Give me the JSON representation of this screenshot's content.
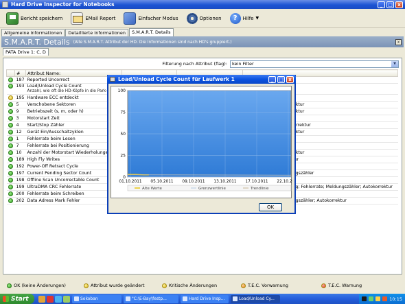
{
  "window": {
    "title": "Hard Drive Inspector for Notebooks",
    "buttons": [
      "_",
      "□",
      "x"
    ]
  },
  "toolbar": {
    "save_label": "Bericht speichern",
    "email_label": "EMail Report",
    "simple_label": "Einfacher Modus",
    "options_label": "Optionen",
    "help_label": "Hilfe"
  },
  "tabs": [
    {
      "label": "Allgemeine Informationen"
    },
    {
      "label": "Detaillierte Informationen"
    },
    {
      "label": "S.M.A.R.T. Details"
    }
  ],
  "header": {
    "title": "S.M.A.R.T. Details",
    "subtitle": "(Alle S.M.A.R.T. Attribut der HD. Die Informationen sind nach HD's gruppiert.)",
    "close": "x"
  },
  "drive_tab": "PATA Drive 1: C, D",
  "filter": {
    "label": "Filterung nach Attribut (flag):",
    "value": "kein Filter"
  },
  "table": {
    "columns": [
      "#",
      "Attribut Name:"
    ],
    "rows": [
      {
        "status": "g",
        "id": "187",
        "name": "Reported Uncorrect",
        "c3": "",
        "c4": "",
        "c5": "Autokorrektur"
      },
      {
        "status": "g",
        "id": "193",
        "name": "Load/Unload Cycle Count",
        "c3": "",
        "c4": "",
        "c5": "Autokorrektur",
        "desc": "Anzahl, wie oft die HD-Köpfe in die Park- oder Arbeitsposition gebracht wurden."
      },
      {
        "status": "y",
        "id": "195",
        "name": "Hardware ECC entdeckt",
        "c3": "",
        "c4": "",
        "c5": "gszähler"
      },
      {
        "status": "g",
        "id": "5",
        "name": "Verschobene Sektoren",
        "c3": "",
        "c4": "",
        "c5": "ldungszähler; Autokorrektur"
      },
      {
        "status": "g",
        "id": "9",
        "name": "Betriebszeit (s, m, oder h)",
        "c3": "",
        "c4": "",
        "c5": "ldungszähler; Autokorrektur"
      },
      {
        "status": "g",
        "id": "3",
        "name": "Motorstart Zeit",
        "c3": "",
        "c4": "",
        "c5": ""
      },
      {
        "status": "g",
        "id": "4",
        "name": "Start/Stop Zähler",
        "c3": "",
        "c4": "",
        "c5": "Meldungszähler; Autokorrektur"
      },
      {
        "status": "g",
        "id": "12",
        "name": "Gerät Ein/Ausschaltzyklen",
        "c3": "",
        "c4": "",
        "c5": "ldungszähler; Autokorrektur"
      },
      {
        "status": "g",
        "id": "1",
        "name": "Fehlerrate beim Lesen",
        "c3": "",
        "c4": "",
        "c5": "Leistung; Fehlerrate"
      },
      {
        "status": "g",
        "id": "7",
        "name": "Fehlerrate bei Positionierung",
        "c3": "",
        "c4": "",
        "c5": "Leistung; Fehlerrate"
      },
      {
        "status": "g",
        "id": "10",
        "name": "Anzahl der Motorstart Wiederholungen",
        "c3": "",
        "c4": "",
        "c5": "ldungszähler; Autokorrektur"
      },
      {
        "status": "g",
        "id": "189",
        "name": "High Fly Writes",
        "c3": "",
        "c4": "",
        "c5": "Fehlerrate; Autokorrektur"
      },
      {
        "status": "g",
        "id": "192",
        "name": "Power-Off Retract Cycle",
        "c3": "",
        "c4": "",
        "c5": "Autokorrektur"
      },
      {
        "status": "g",
        "id": "197",
        "name": "Current Pending Sector Count",
        "c3": "100%",
        "c4": "100",
        "c5": "Online Statistik; Meldungszähler"
      },
      {
        "status": "g",
        "id": "198",
        "name": "Offline Scan Uncorrectable Count",
        "c3": "100%",
        "c4": "100",
        "c5": "Meldungszähler"
      },
      {
        "status": "g",
        "id": "199",
        "name": "UltraDMA CRC Fehlerrate",
        "c3": "100%",
        "c4": "200",
        "c5": "Online Statistik; Leistung; Fehlerrate; Meldungszähler; Autokorrektur"
      },
      {
        "status": "g",
        "id": "200",
        "name": "Fehlerrate beim Schreiben",
        "c3": "100%",
        "c4": "100",
        "c5": "Fehlerrate"
      },
      {
        "status": "g",
        "id": "202",
        "name": "Data Adress Mark Fehler",
        "c3": "100%",
        "c4": "100",
        "c5": "Online Statistik; Meldungszähler; Autokorrektur"
      }
    ]
  },
  "legend": [
    {
      "color": "g",
      "label": "OK (keine Änderungen)"
    },
    {
      "color": "y",
      "label": "Attribut wurde geändert"
    },
    {
      "color": "y",
      "label": "Kritische Änderungen"
    },
    {
      "color": "o",
      "label": "T.E.C. Vorwarnung"
    },
    {
      "color": "r",
      "label": "T.E.C. Warnung"
    }
  ],
  "dialog": {
    "title": "Load/Unload Cycle Count für Laufwerk 1",
    "ok_label": "OK"
  },
  "chart_data": {
    "type": "line",
    "yticks": [
      0,
      25,
      50,
      75,
      100
    ],
    "ylim": [
      0,
      100
    ],
    "x_tick_labels": [
      "01.10.2011",
      "05.10.2011",
      "09.10.2011",
      "13.10.2011",
      "17.10.2011",
      "22.10.2011"
    ],
    "series": [
      {
        "name": "Alte Werte",
        "color": "#e8c300",
        "x": [
          0,
          0.05,
          0.1,
          0.13
        ],
        "values": [
          3,
          3,
          2.5,
          2.5
        ]
      },
      {
        "name": "Grenzwertlinie",
        "color": "#c7d6e8",
        "x": [
          0,
          1
        ],
        "values": [
          0,
          0
        ]
      },
      {
        "name": "Trendlinie",
        "color": "#d4c7b0",
        "x": [
          0,
          1
        ],
        "values": [
          2.6,
          2.2
        ]
      }
    ],
    "background": "#3c89e0",
    "grid": true
  },
  "taskbar": {
    "start_label": "Start",
    "tasks": [
      {
        "label": "Sokoban",
        "active": false
      },
      {
        "label": "\"C:\\E-Bay\\festp...",
        "active": false
      },
      {
        "label": "Hard Drive Insp...",
        "active": false
      },
      {
        "label": "Load/Unload Cy...",
        "active": true
      }
    ],
    "clock": "10:15"
  }
}
